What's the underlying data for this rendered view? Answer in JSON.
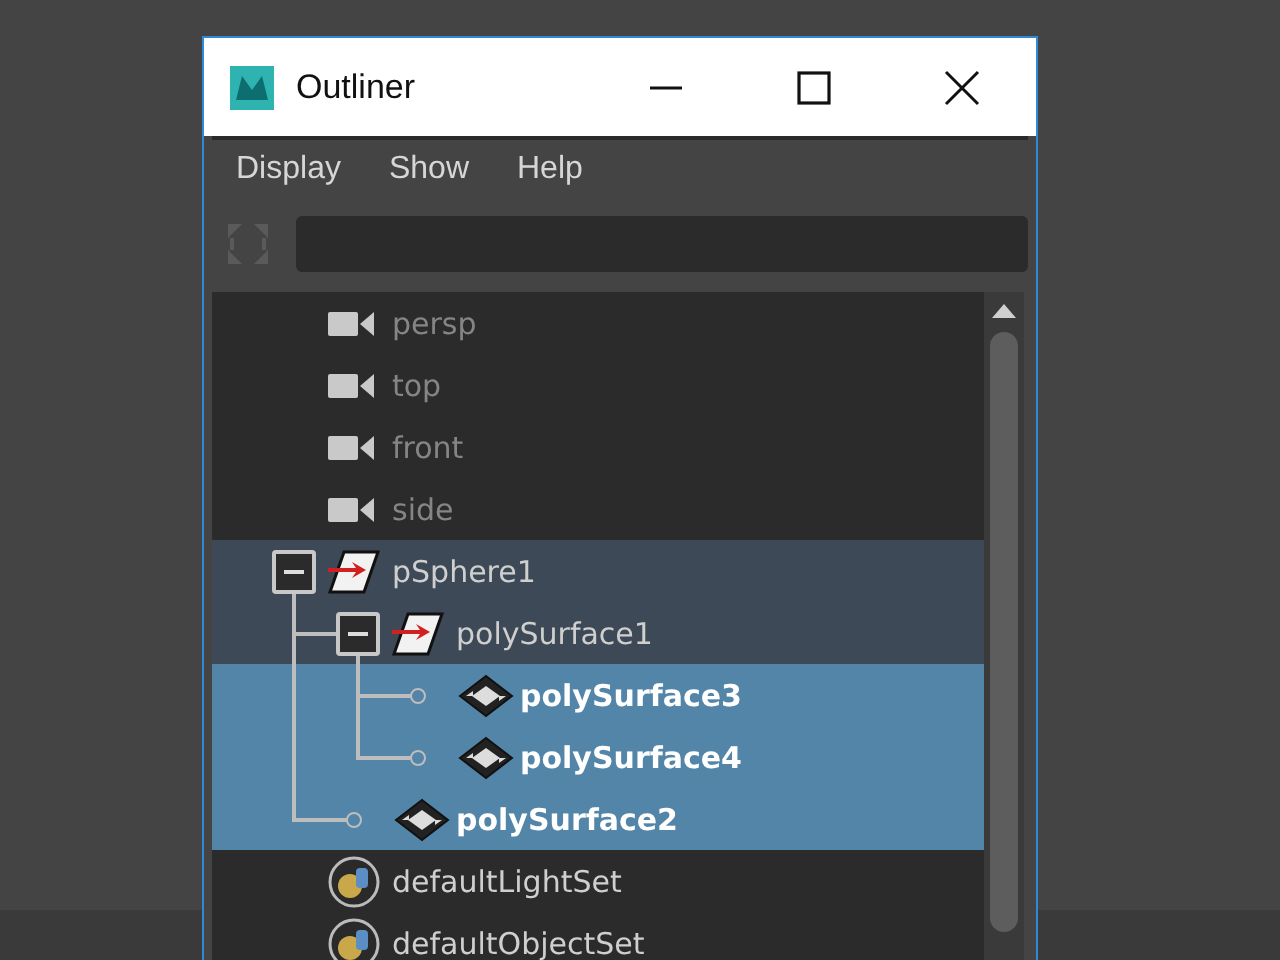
{
  "window": {
    "title": "Outliner"
  },
  "menu": [
    "Display",
    "Show",
    "Help"
  ],
  "tree": {
    "items": [
      {
        "label": "persp",
        "kind": "camera",
        "selected": false,
        "highlighted": false,
        "dimmed": true
      },
      {
        "label": "top",
        "kind": "camera",
        "selected": false,
        "highlighted": false,
        "dimmed": true
      },
      {
        "label": "front",
        "kind": "camera",
        "selected": false,
        "highlighted": false,
        "dimmed": true
      },
      {
        "label": "side",
        "kind": "camera",
        "selected": false,
        "highlighted": false,
        "dimmed": true
      },
      {
        "label": "pSphere1",
        "kind": "transform",
        "selected": false,
        "highlighted": true,
        "dimmed": false,
        "expanded": true,
        "children": [
          {
            "label": "polySurface1",
            "kind": "transform",
            "selected": false,
            "highlighted": true,
            "dimmed": false,
            "expanded": true,
            "children": [
              {
                "label": "polySurface3",
                "kind": "mesh",
                "selected": true,
                "highlighted": false,
                "dimmed": false
              },
              {
                "label": "polySurface4",
                "kind": "mesh",
                "selected": true,
                "highlighted": false,
                "dimmed": false
              }
            ]
          },
          {
            "label": "polySurface2",
            "kind": "mesh",
            "selected": true,
            "highlighted": false,
            "dimmed": false
          }
        ]
      },
      {
        "label": "defaultLightSet",
        "kind": "set",
        "selected": false,
        "highlighted": false,
        "dimmed": false
      },
      {
        "label": "defaultObjectSet",
        "kind": "set",
        "selected": false,
        "highlighted": false,
        "dimmed": false
      }
    ]
  }
}
